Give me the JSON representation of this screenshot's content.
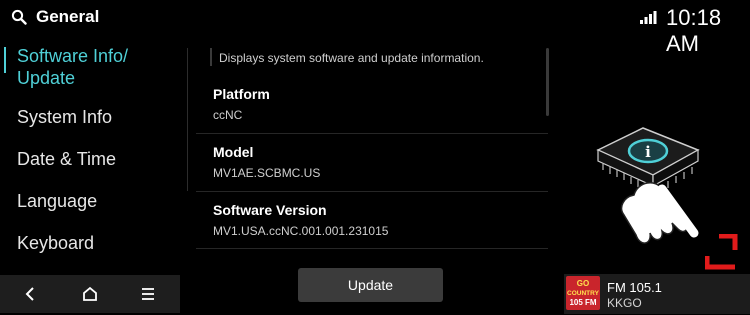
{
  "header": {
    "title": "General",
    "time": "10:18 AM"
  },
  "sidebar": {
    "items": [
      {
        "label": "Software Info/",
        "label2": "Update",
        "active": true
      },
      {
        "label": "System Info"
      },
      {
        "label": "Date & Time"
      },
      {
        "label": "Language"
      },
      {
        "label": "Keyboard"
      }
    ]
  },
  "content": {
    "description": "Displays system software and update information.",
    "rows": [
      {
        "label": "Platform",
        "value": "ccNC"
      },
      {
        "label": "Model",
        "value": "MV1AE.SCBMC.US"
      },
      {
        "label": "Software Version",
        "value": "MV1.USA.ccNC.001.001.231015"
      }
    ]
  },
  "update_button": {
    "label": "Update"
  },
  "navbar": {
    "back_icon": "back-chevron-icon",
    "home_icon": "home-icon",
    "menu_icon": "menu-icon"
  },
  "radio": {
    "logo_text": [
      "GO",
      "COUNTRY",
      "105 FM"
    ],
    "station": "FM 105.1",
    "call_sign": "KKGO"
  },
  "colors": {
    "accent": "#4fd0d7",
    "background": "#000000",
    "tap_marker": "#e11b1b",
    "radio_logo": "#c9252c"
  }
}
